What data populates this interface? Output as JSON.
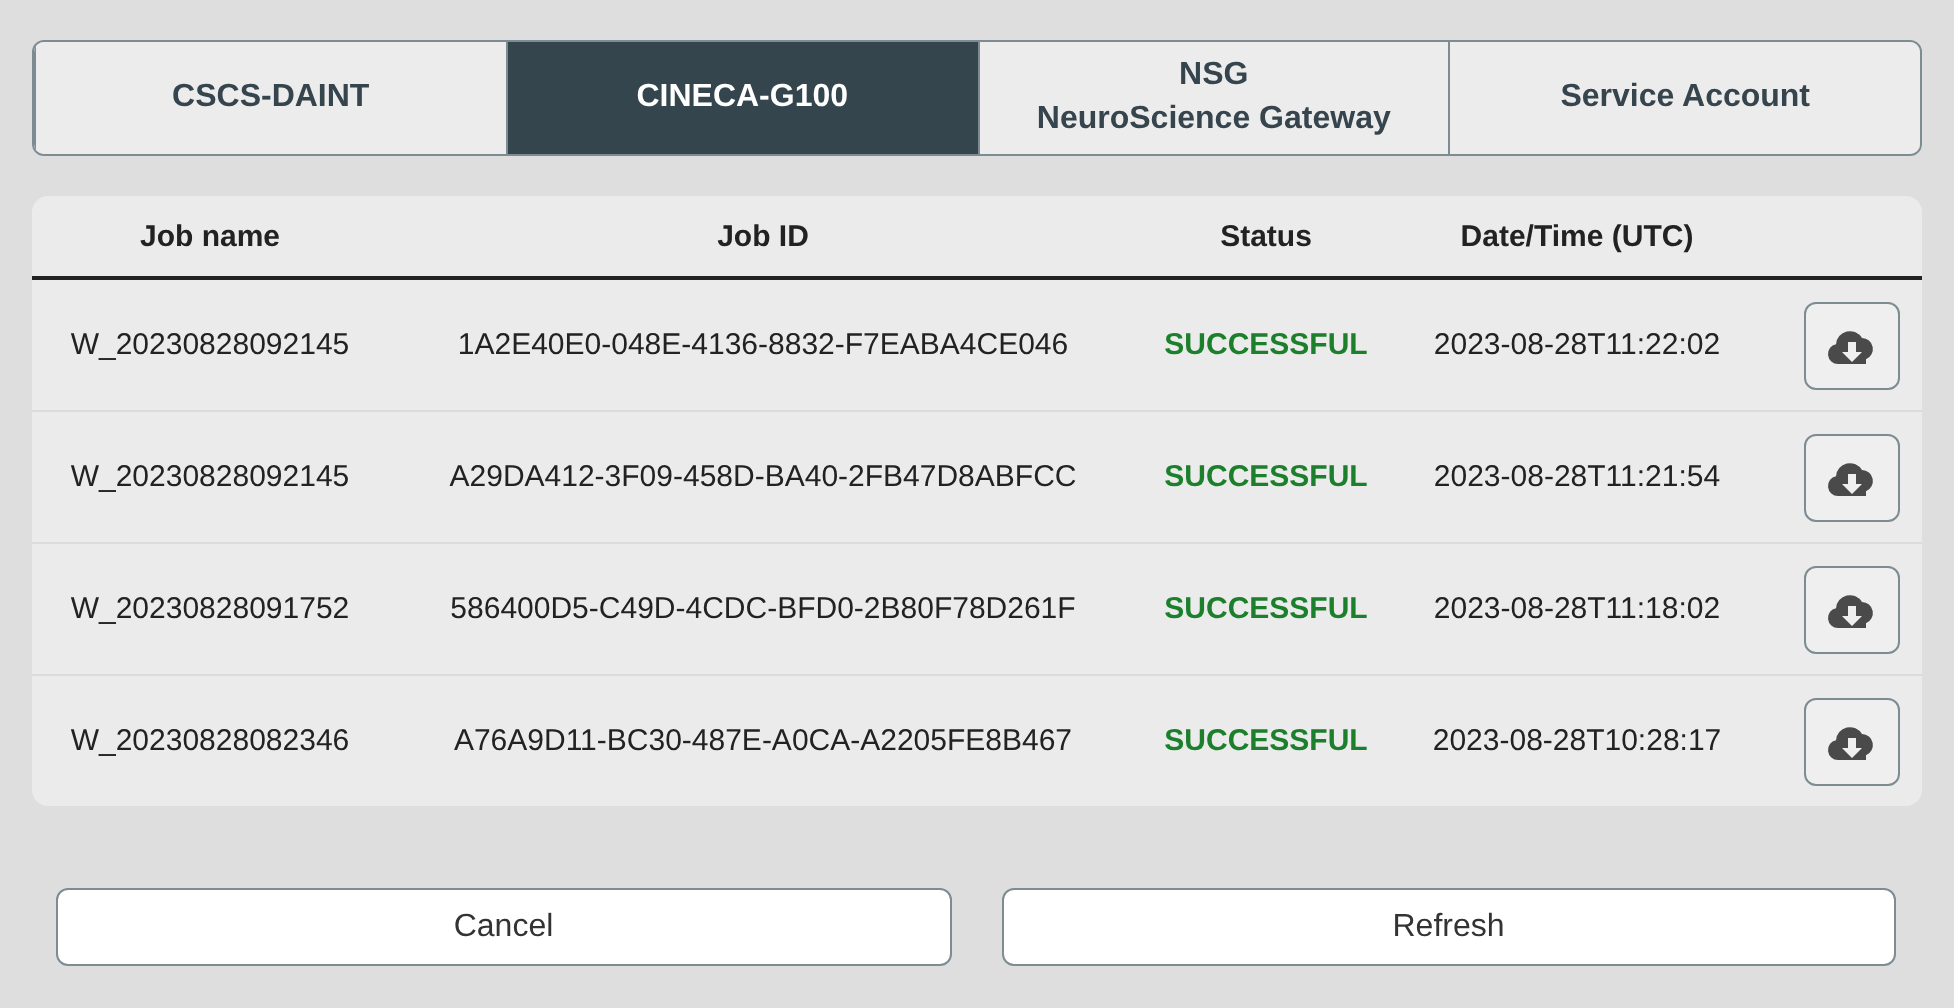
{
  "tabs": [
    {
      "label": "CSCS-DAINT",
      "selected": false
    },
    {
      "label": "CINECA-G100",
      "selected": true
    },
    {
      "label": "NSG\nNeuroScience Gateway",
      "selected": false
    },
    {
      "label": "Service Account",
      "selected": false
    }
  ],
  "table": {
    "columns": [
      "Job name",
      "Job ID",
      "Status",
      "Date/Time (UTC)"
    ],
    "rows": [
      {
        "job_name": "W_20230828092145",
        "job_id": "1A2E40E0-048E-4136-8832-F7EABA4CE046",
        "status": "SUCCESSFUL",
        "datetime": "2023-08-28T11:22:02"
      },
      {
        "job_name": "W_20230828092145",
        "job_id": "A29DA412-3F09-458D-BA40-2FB47D8ABFCC",
        "status": "SUCCESSFUL",
        "datetime": "2023-08-28T11:21:54"
      },
      {
        "job_name": "W_20230828091752",
        "job_id": "586400D5-C49D-4CDC-BFD0-2B80F78D261F",
        "status": "SUCCESSFUL",
        "datetime": "2023-08-28T11:18:02"
      },
      {
        "job_name": "W_20230828082346",
        "job_id": "A76A9D11-BC30-487E-A0CA-A2205FE8B467",
        "status": "SUCCESSFUL",
        "datetime": "2023-08-28T10:28:17"
      }
    ]
  },
  "buttons": [
    "Cancel",
    "Refresh"
  ]
}
